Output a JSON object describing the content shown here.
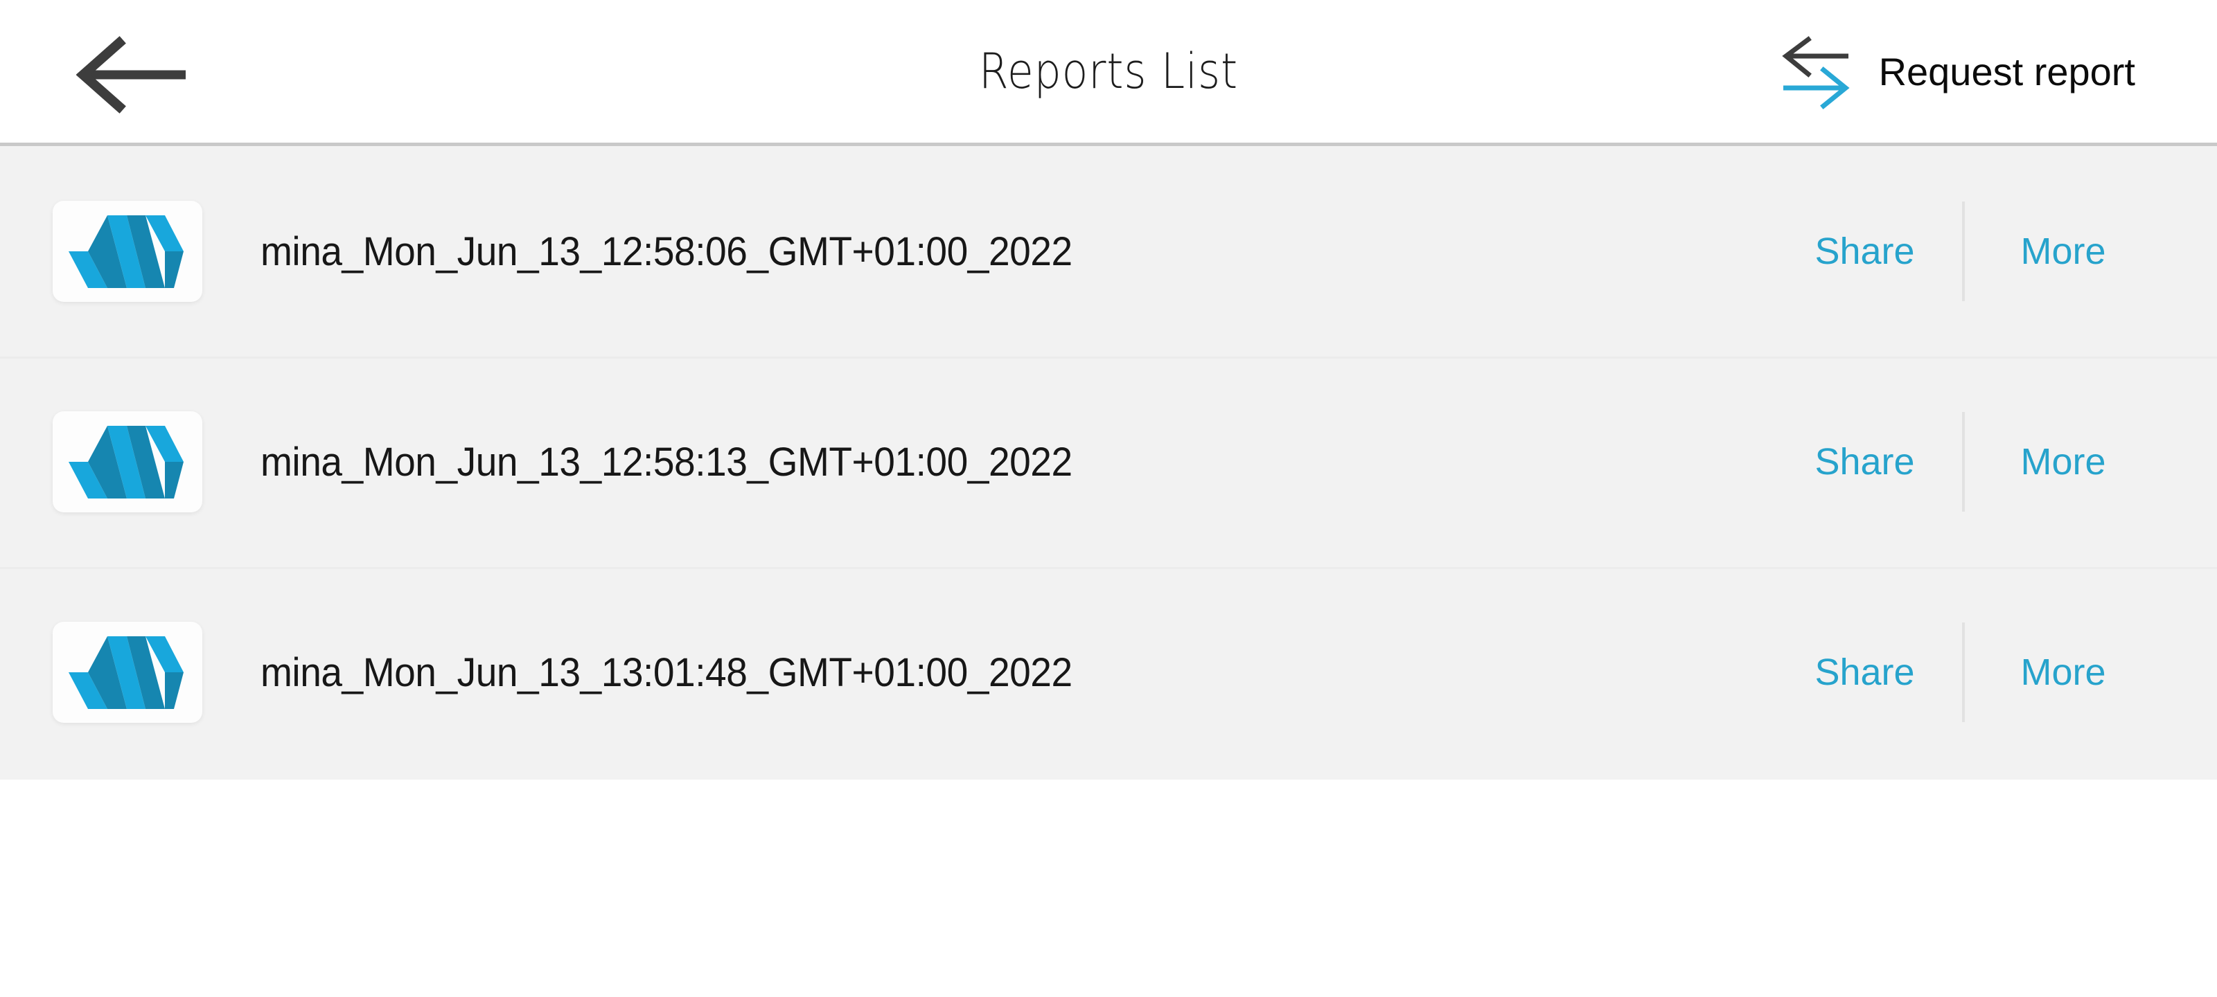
{
  "header": {
    "title": "Reports List",
    "back_icon": "arrow-left-icon",
    "request_report": {
      "label": "Request report",
      "icon": "transfer-arrows-icon",
      "icon_top_arrow_color": "#3d3d3d",
      "icon_bottom_arrow_color": "#29a8d6"
    },
    "border_color": "#c9c9c9",
    "background": "#ffffff"
  },
  "list": {
    "background": "#f2f2f2",
    "row_separator_color": "#ececec",
    "action_color": "#27a3cc",
    "divider_color": "#e2e2e2",
    "logo": {
      "icon": "mina-waveform-logo",
      "card_background": "#fdfdfd",
      "color_light": "#18a7dc",
      "color_dark": "#1686b0"
    },
    "actions": {
      "share_label": "Share",
      "more_label": "More"
    },
    "rows": [
      {
        "name": "mina_Mon_Jun_13_12:58:06_GMT+01:00_2022"
      },
      {
        "name": "mina_Mon_Jun_13_12:58:13_GMT+01:00_2022"
      },
      {
        "name": "mina_Mon_Jun_13_13:01:48_GMT+01:00_2022"
      }
    ]
  },
  "footer": {
    "background": "#ffffff"
  }
}
